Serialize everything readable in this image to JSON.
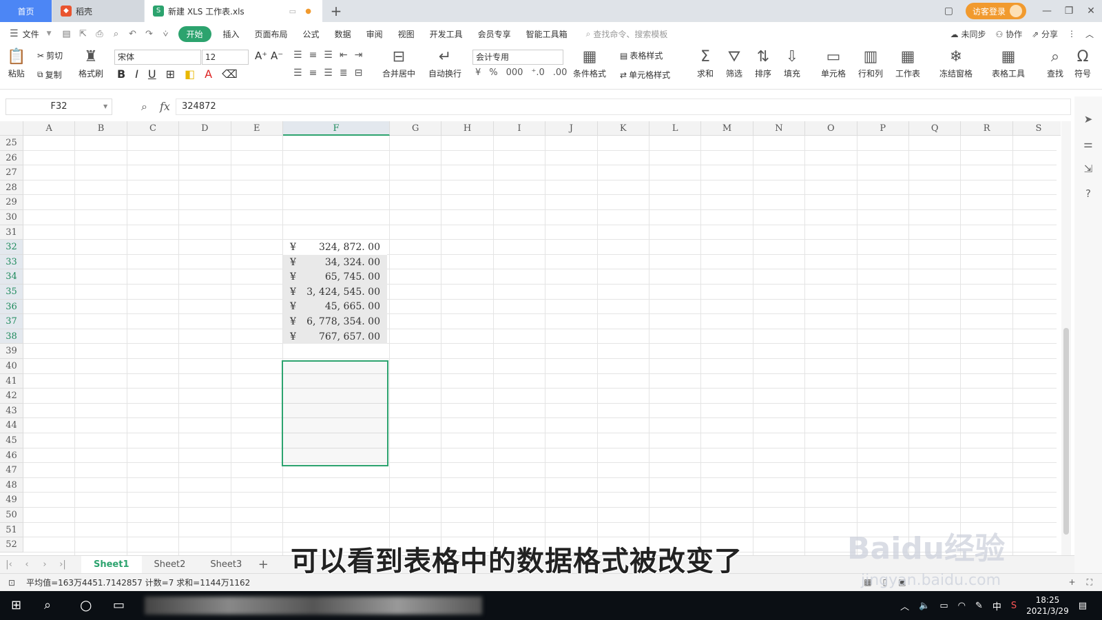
{
  "titlebar": {
    "home_tab": "首页",
    "daoke_tab": "稻壳",
    "file_tab": "新建 XLS 工作表.xls",
    "login": "访客登录"
  },
  "menubar": {
    "file": "文件",
    "items": [
      "开始",
      "插入",
      "页面布局",
      "公式",
      "数据",
      "审阅",
      "视图",
      "开发工具",
      "会员专享",
      "智能工具箱"
    ],
    "search_placeholder": "查找命令、搜索模板",
    "sync": "未同步",
    "collab": "协作",
    "share": "分享"
  },
  "ribbon": {
    "paste": "粘贴",
    "cut": "剪切",
    "copy": "复制",
    "format_painter": "格式刷",
    "font_name": "宋体",
    "font_size": "12",
    "merge_center": "合并居中",
    "auto_wrap": "自动换行",
    "number_format": "会计专用",
    "cond_format": "条件格式",
    "table_style": "表格样式",
    "cell_style": "单元格样式",
    "sum": "求和",
    "filter": "筛选",
    "sort": "排序",
    "fill": "填充",
    "cell": "单元格",
    "row_col": "行和列",
    "worksheet": "工作表",
    "freeze": "冻结窗格",
    "table_tools": "表格工具",
    "find": "查找",
    "symbol": "符号"
  },
  "formula_bar": {
    "name_box": "F32",
    "fx": "fx",
    "value": "324872"
  },
  "columns": [
    "A",
    "B",
    "C",
    "D",
    "E",
    "F",
    "G",
    "H",
    "I",
    "J",
    "K",
    "L",
    "M",
    "N",
    "O",
    "P",
    "Q",
    "R",
    "S"
  ],
  "rows": [
    "25",
    "26",
    "27",
    "28",
    "29",
    "30",
    "31",
    "32",
    "33",
    "34",
    "35",
    "36",
    "37",
    "38",
    "39",
    "40",
    "41",
    "42",
    "43",
    "44",
    "45",
    "46",
    "47",
    "48",
    "49",
    "50",
    "51",
    "52"
  ],
  "cells": [
    {
      "currency": "¥",
      "value": "324, 872. 00"
    },
    {
      "currency": "¥",
      "value": "34, 324. 00"
    },
    {
      "currency": "¥",
      "value": "65, 745. 00"
    },
    {
      "currency": "¥",
      "value": "3, 424, 545. 00"
    },
    {
      "currency": "¥",
      "value": "45, 665. 00"
    },
    {
      "currency": "¥",
      "value": "6, 778, 354. 00"
    },
    {
      "currency": "¥",
      "value": "767, 657. 00"
    }
  ],
  "sheets": [
    "Sheet1",
    "Sheet2",
    "Sheet3"
  ],
  "status": {
    "summary": "平均值=163万4451.7142857 计数=7 求和=1144万1162"
  },
  "subtitle": "可以看到表格中的数据格式被改变了",
  "watermark": {
    "logo": "Baidu经验",
    "url": "jingyan.baidu.com"
  },
  "taskbar": {
    "time": "18:25",
    "date": "2021/3/29",
    "ime": "中"
  },
  "colors": {
    "accent": "#2ca36e",
    "home_tab": "#4c86f5",
    "login": "#f19a2e"
  }
}
